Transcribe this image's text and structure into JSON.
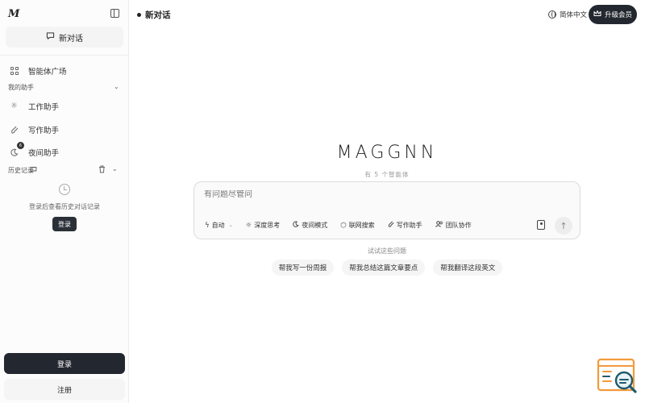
{
  "sidebar": {
    "logo": "M",
    "new_chat_label": "新对话",
    "nav_top": "智能体广场",
    "section_label": "我的助手",
    "assistants": [
      {
        "label": "工作助手",
        "icon": "sun-icon"
      },
      {
        "label": "写作助手",
        "icon": "brush-icon"
      },
      {
        "label": "夜间助手",
        "icon": "moon-icon"
      }
    ],
    "badge": "6",
    "history_label": "历史记录",
    "empty_text": "登录后查看历史对话记录",
    "login_small": "登录",
    "login_button": "登录",
    "register_button": "注册"
  },
  "header": {
    "title": "新对话",
    "language": "简体中文",
    "upgrade": "升级会员"
  },
  "main": {
    "brand": "MAGGNN",
    "brand_sub": "有 5 个智能体",
    "composer_placeholder": "有问题尽管问",
    "tools": [
      {
        "label": "自动",
        "icon": "bolt-icon",
        "dropdown": true
      },
      {
        "label": "深度思考",
        "icon": "sun-icon"
      },
      {
        "label": "夜间模式",
        "icon": "moon-icon"
      },
      {
        "label": "联网搜索",
        "icon": "hexagon-icon"
      },
      {
        "label": "写作助手",
        "icon": "brush-icon"
      },
      {
        "label": "团队协作",
        "icon": "users-icon"
      }
    ],
    "suggest_label": "试试这些问题",
    "suggestions": [
      "帮我写一份周报",
      "帮我总结这篇文章要点",
      "帮我翻译这段英文"
    ]
  },
  "colors": {
    "dark_button": "#23272f",
    "accent_orange": "#f39a3b",
    "accent_teal": "#1f5a6b"
  }
}
